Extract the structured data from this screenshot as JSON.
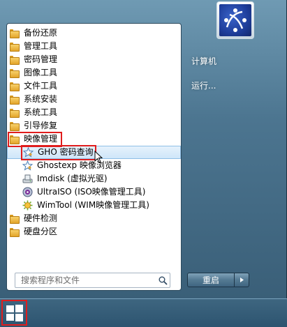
{
  "left_pane": {
    "folders_top": [
      {
        "label": "备份还原"
      },
      {
        "label": "管理工具"
      },
      {
        "label": "密码管理"
      },
      {
        "label": "图像工具"
      },
      {
        "label": "文件工具"
      },
      {
        "label": "系统安装"
      },
      {
        "label": "系统工具"
      },
      {
        "label": "引导修复"
      },
      {
        "label": "映像管理"
      }
    ],
    "sub_items": [
      {
        "label": "GHO 密码查询",
        "icon": "star-key-icon"
      },
      {
        "label": "Ghostexp 映像浏览器",
        "icon": "star-key-icon"
      },
      {
        "label": "Imdisk (虚拟光驱)",
        "icon": "disk-drive-icon"
      },
      {
        "label": "UltraISO (ISO映像管理工具)",
        "icon": "ultraiso-icon"
      },
      {
        "label": "WimTool (WIM映像管理工具)",
        "icon": "wimtool-icon"
      }
    ],
    "folders_bottom": [
      {
        "label": "硬件检测"
      },
      {
        "label": "硬盘分区"
      }
    ],
    "search_placeholder": "搜索程序和文件"
  },
  "right_pane": {
    "computer_label": "计算机",
    "run_label": "运行...",
    "restart_label": "重启"
  },
  "colors": {
    "highlight_border": "#e01d1d",
    "selection_bg": "#cfe6f9"
  }
}
